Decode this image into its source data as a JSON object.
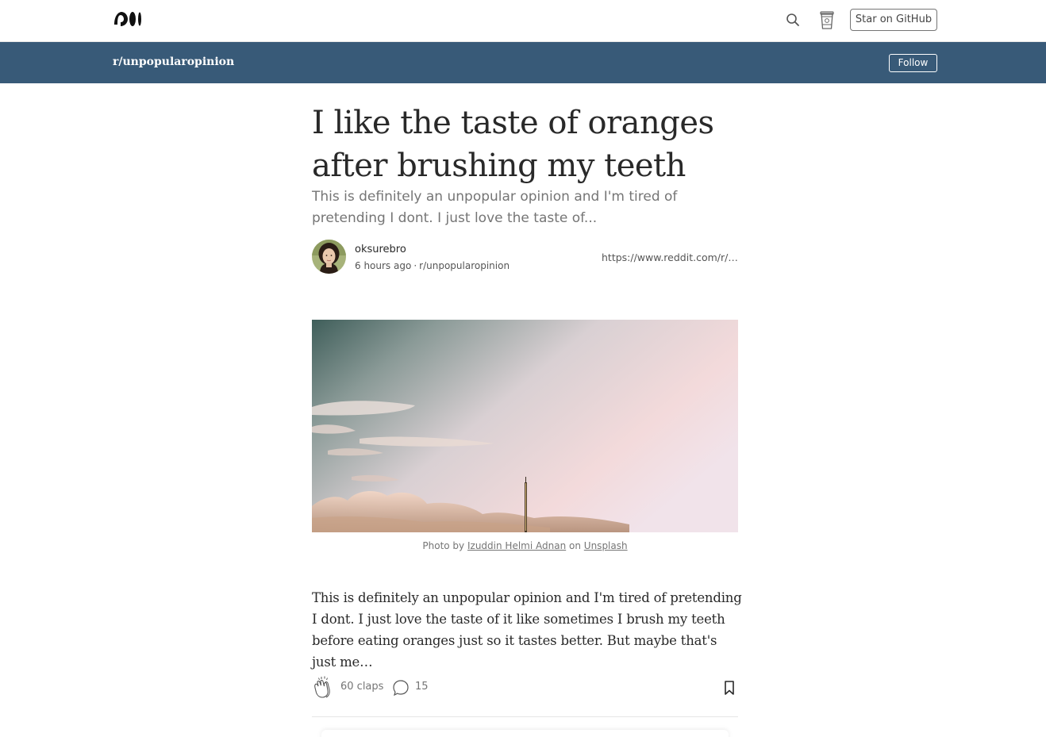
{
  "header": {
    "logo_icon": "medium-logo-icon",
    "search_icon": "search-icon",
    "cup_icon": "coffee-cup-icon",
    "github_label": "Star on GitHub"
  },
  "subreddit_bar": {
    "name": "r/unpopularopinion",
    "follow_label": "Follow",
    "color": "#385a78"
  },
  "article": {
    "title": "I like the taste of oranges after brushing my teeth",
    "subtitle": "This is definitely an unpopular opinion and I'm tired of pretending I dont. I just love the taste of...",
    "author": "oksurebro",
    "time": "6 hours ago",
    "separator": "·",
    "subreddit": "r/unpopularopinion",
    "source_link": "https://www.reddit.com/r/unpopularopinion",
    "image_caption": {
      "prefix": "Photo by",
      "photographer": "Izuddin Helmi Adnan",
      "middle": "on",
      "site": "Unsplash"
    },
    "body": "This is definitely an unpopular opinion and I'm tired of pretending I dont. I just love the taste of it like sometimes I brush my teeth before eating oranges just so it tastes better. But maybe that's just me…",
    "claps": "60 claps",
    "responses": "15"
  }
}
